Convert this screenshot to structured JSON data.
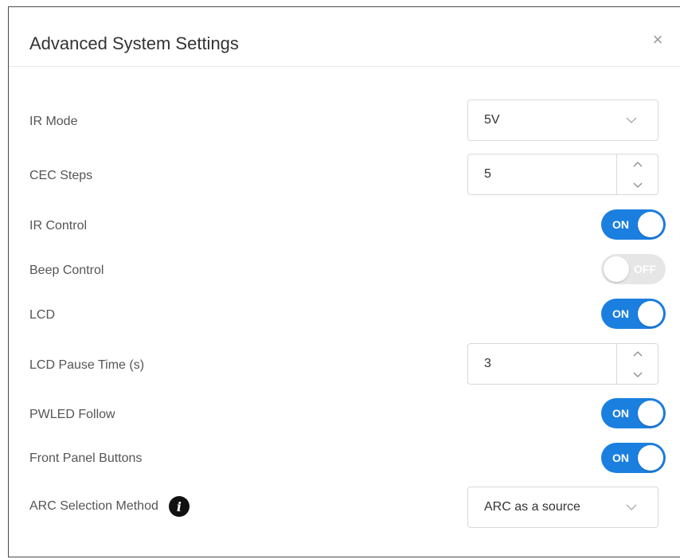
{
  "dialog": {
    "title": "Advanced System Settings",
    "close_glyph": "×"
  },
  "settings": {
    "ir_mode": {
      "label": "IR Mode",
      "value": "5V"
    },
    "cec_steps": {
      "label": "CEC Steps",
      "value": "5"
    },
    "ir_control": {
      "label": "IR Control",
      "state": "ON"
    },
    "beep_control": {
      "label": "Beep Control",
      "state": "OFF"
    },
    "lcd": {
      "label": "LCD",
      "state": "ON"
    },
    "lcd_pause_time": {
      "label": "LCD Pause Time (s)",
      "value": "3"
    },
    "pwled_follow": {
      "label": "PWLED Follow",
      "state": "ON"
    },
    "front_panel_buttons": {
      "label": "Front Panel Buttons",
      "state": "ON"
    },
    "arc_selection_method": {
      "label": "ARC Selection Method",
      "info_glyph": "i",
      "value": "ARC as a source"
    }
  },
  "colors": {
    "toggle_on": "#1b7fe0",
    "toggle_off": "#e6e6e6"
  }
}
